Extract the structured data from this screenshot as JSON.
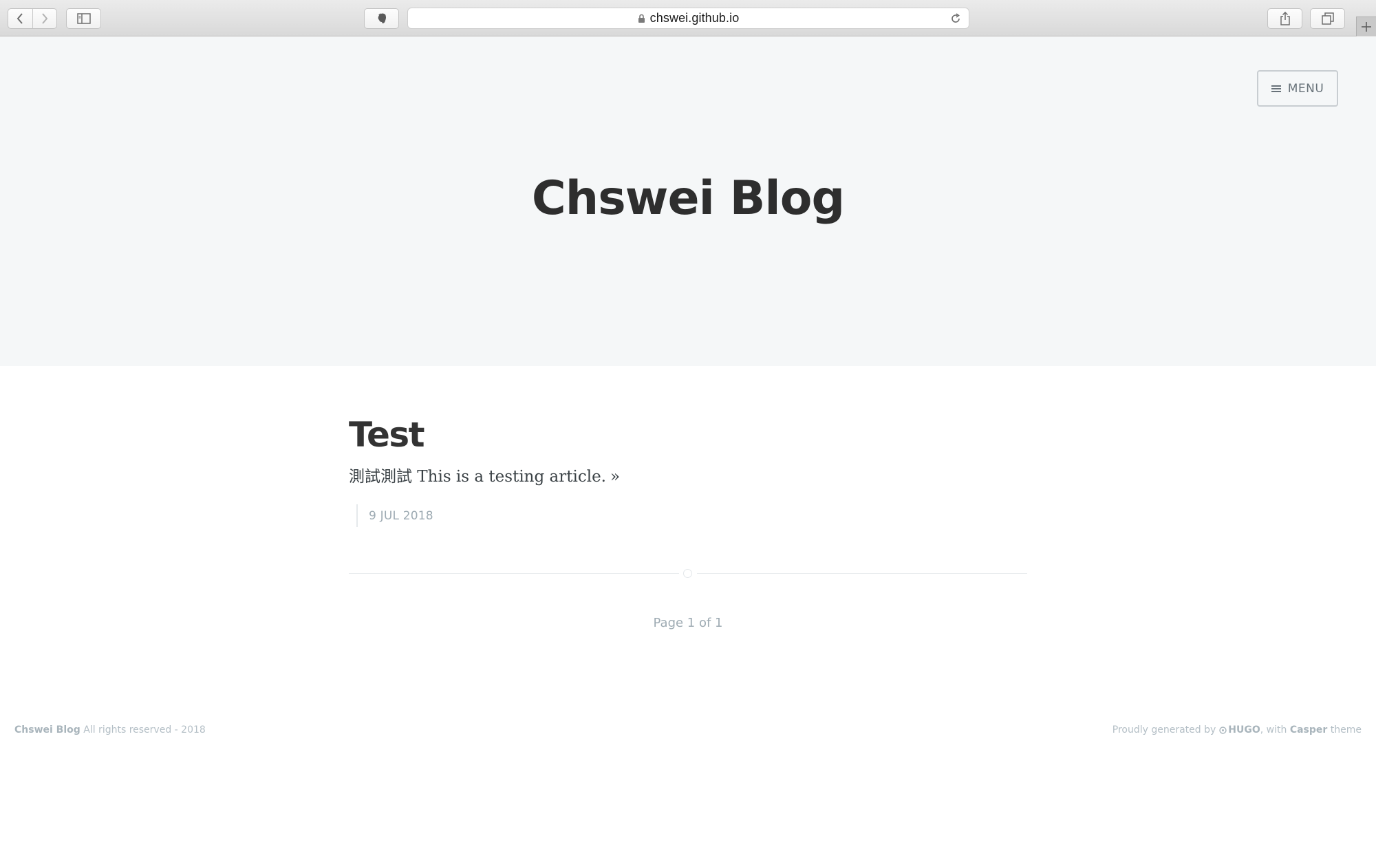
{
  "browser": {
    "url": "chswei.github.io",
    "icons": {
      "back": "chevron-left-icon",
      "forward": "chevron-right-icon",
      "sidebar": "sidebar-icon",
      "extension": "evernote-elephant-icon",
      "lock": "lock-icon",
      "reload": "reload-icon",
      "share": "share-icon",
      "tabs": "tab-overview-icon",
      "new_tab": "plus-icon"
    }
  },
  "header": {
    "menu_label": "MENU",
    "site_title": "Chswei Blog"
  },
  "posts": [
    {
      "title": "Test",
      "excerpt": "測試測試 This is a testing article.",
      "more": "»",
      "date": "9 JUL 2018"
    }
  ],
  "pagination": {
    "text": "Page 1 of 1"
  },
  "footer": {
    "site_name": "Chswei Blog",
    "rights": "All rights reserved - 2018",
    "generated_prefix": "Proudly generated by",
    "generator": "HUGO",
    "with_text": ", with",
    "theme_name": "Casper",
    "theme_suffix": "theme"
  },
  "colors": {
    "header_bg": "#f5f7f8",
    "title": "#2e2e2e",
    "meta": "#9eabb3",
    "footer_text": "#b4bfc6"
  }
}
